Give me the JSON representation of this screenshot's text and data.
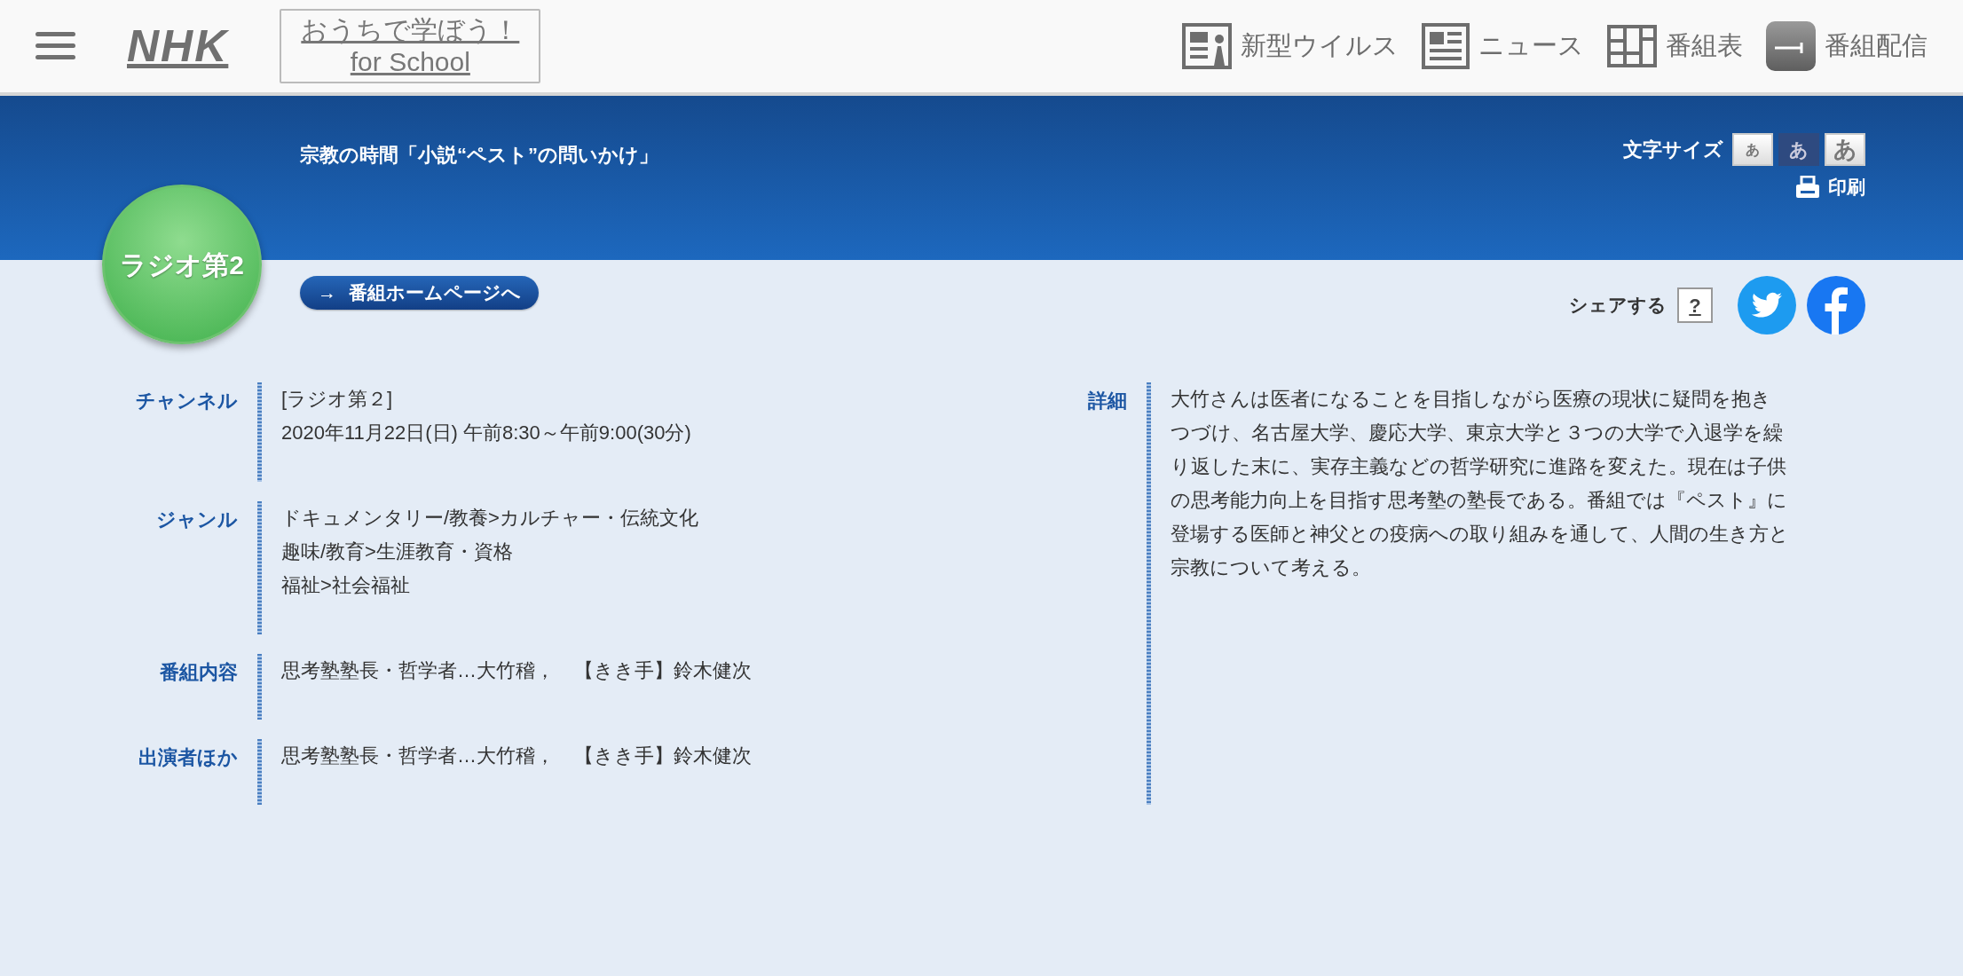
{
  "header": {
    "brand": "NHK",
    "school_badge": [
      "おうちで学ぼう！",
      "for School"
    ],
    "nav": [
      {
        "kind": "virus",
        "label": "新型ウイルス"
      },
      {
        "kind": "news",
        "label": "ニュース"
      },
      {
        "kind": "schedule",
        "label": "番組表"
      },
      {
        "kind": "stream",
        "label": "番組配信"
      }
    ]
  },
  "program": {
    "title": "宗教の時間「小説“ペスト”の問いかけ」",
    "channel_logo": "ラジオ第2",
    "homepage_link": {
      "arrow": "→",
      "label": "番組ホームページへ"
    }
  },
  "font_size": {
    "label": "文字サイズ",
    "options": [
      {
        "label": "あ",
        "selected": false
      },
      {
        "label": "あ",
        "selected": true
      },
      {
        "label": "あ",
        "selected": false
      }
    ]
  },
  "print": "印刷",
  "share": {
    "label": "シェアする",
    "help": "?"
  },
  "details": [
    {
      "label": "チャンネル",
      "lines": [
        "[ラジオ第２]",
        "2020年11月22日(日) 午前8:30～午前9:00(30分)"
      ]
    },
    {
      "label": "ジャンル",
      "lines": [
        "ドキュメンタリー/教養>カルチャー・伝統文化",
        "趣味/教育>生涯教育・資格",
        "福祉>社会福祉"
      ]
    },
    {
      "label": "番組内容",
      "lines": [
        "思考塾塾長・哲学者…大竹稽，　【きき手】鈴木健次"
      ]
    },
    {
      "label": "出演者ほか",
      "lines": [
        "思考塾塾長・哲学者…大竹稽，　【きき手】鈴木健次"
      ]
    }
  ],
  "description": {
    "label": "詳細",
    "text": "大竹さんは医者になることを目指しながら医療の現状に疑問を抱きつづけ、名古屋大学、慶応大学、東京大学と３つの大学で入退学を繰り返した末に、実存主義などの哲学研究に進路を変えた。現在は子供の思考能力向上を目指す思考塾の塾長である。番組では『ペスト』に登場する医師と神父との疫病への取り組みを通して、人間の生き方と宗教について考える。"
  }
}
